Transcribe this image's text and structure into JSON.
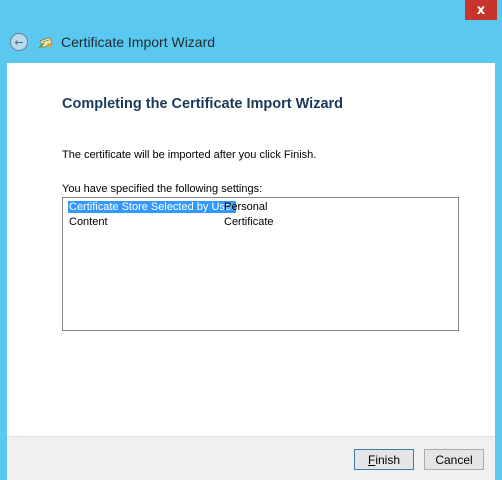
{
  "window": {
    "title": "Certificate Import Wizard",
    "close_glyph": "x",
    "back_glyph": "←"
  },
  "page": {
    "heading": "Completing the Certificate Import Wizard",
    "description": "The certificate will be imported after you click Finish.",
    "settings_label": "You have specified the following settings:"
  },
  "settings": [
    {
      "key": "Certificate Store Selected by User",
      "value": "Personal",
      "selected": true
    },
    {
      "key": "Content",
      "value": "Certificate",
      "selected": false
    }
  ],
  "buttons": {
    "finish_mnemonic": "F",
    "finish_rest": "inish",
    "cancel": "Cancel"
  },
  "colors": {
    "chrome": "#5bc8f0",
    "close": "#c7342b",
    "heading": "#1a3a5c",
    "selection": "#3399ff"
  },
  "icons": {
    "back": "back-arrow-icon",
    "wizard": "certificate-wizard-icon",
    "close": "close-icon"
  }
}
